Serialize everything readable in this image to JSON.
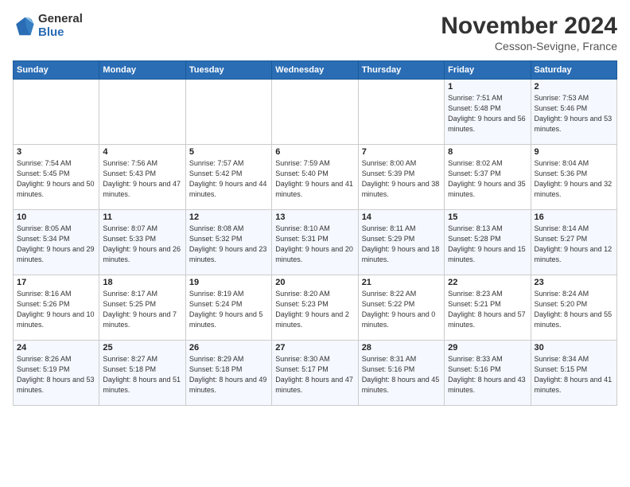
{
  "logo": {
    "general": "General",
    "blue": "Blue"
  },
  "header": {
    "month": "November 2024",
    "location": "Cesson-Sevigne, France"
  },
  "weekdays": [
    "Sunday",
    "Monday",
    "Tuesday",
    "Wednesday",
    "Thursday",
    "Friday",
    "Saturday"
  ],
  "weeks": [
    [
      {
        "day": "",
        "info": ""
      },
      {
        "day": "",
        "info": ""
      },
      {
        "day": "",
        "info": ""
      },
      {
        "day": "",
        "info": ""
      },
      {
        "day": "",
        "info": ""
      },
      {
        "day": "1",
        "info": "Sunrise: 7:51 AM\nSunset: 5:48 PM\nDaylight: 9 hours and 56 minutes."
      },
      {
        "day": "2",
        "info": "Sunrise: 7:53 AM\nSunset: 5:46 PM\nDaylight: 9 hours and 53 minutes."
      }
    ],
    [
      {
        "day": "3",
        "info": "Sunrise: 7:54 AM\nSunset: 5:45 PM\nDaylight: 9 hours and 50 minutes."
      },
      {
        "day": "4",
        "info": "Sunrise: 7:56 AM\nSunset: 5:43 PM\nDaylight: 9 hours and 47 minutes."
      },
      {
        "day": "5",
        "info": "Sunrise: 7:57 AM\nSunset: 5:42 PM\nDaylight: 9 hours and 44 minutes."
      },
      {
        "day": "6",
        "info": "Sunrise: 7:59 AM\nSunset: 5:40 PM\nDaylight: 9 hours and 41 minutes."
      },
      {
        "day": "7",
        "info": "Sunrise: 8:00 AM\nSunset: 5:39 PM\nDaylight: 9 hours and 38 minutes."
      },
      {
        "day": "8",
        "info": "Sunrise: 8:02 AM\nSunset: 5:37 PM\nDaylight: 9 hours and 35 minutes."
      },
      {
        "day": "9",
        "info": "Sunrise: 8:04 AM\nSunset: 5:36 PM\nDaylight: 9 hours and 32 minutes."
      }
    ],
    [
      {
        "day": "10",
        "info": "Sunrise: 8:05 AM\nSunset: 5:34 PM\nDaylight: 9 hours and 29 minutes."
      },
      {
        "day": "11",
        "info": "Sunrise: 8:07 AM\nSunset: 5:33 PM\nDaylight: 9 hours and 26 minutes."
      },
      {
        "day": "12",
        "info": "Sunrise: 8:08 AM\nSunset: 5:32 PM\nDaylight: 9 hours and 23 minutes."
      },
      {
        "day": "13",
        "info": "Sunrise: 8:10 AM\nSunset: 5:31 PM\nDaylight: 9 hours and 20 minutes."
      },
      {
        "day": "14",
        "info": "Sunrise: 8:11 AM\nSunset: 5:29 PM\nDaylight: 9 hours and 18 minutes."
      },
      {
        "day": "15",
        "info": "Sunrise: 8:13 AM\nSunset: 5:28 PM\nDaylight: 9 hours and 15 minutes."
      },
      {
        "day": "16",
        "info": "Sunrise: 8:14 AM\nSunset: 5:27 PM\nDaylight: 9 hours and 12 minutes."
      }
    ],
    [
      {
        "day": "17",
        "info": "Sunrise: 8:16 AM\nSunset: 5:26 PM\nDaylight: 9 hours and 10 minutes."
      },
      {
        "day": "18",
        "info": "Sunrise: 8:17 AM\nSunset: 5:25 PM\nDaylight: 9 hours and 7 minutes."
      },
      {
        "day": "19",
        "info": "Sunrise: 8:19 AM\nSunset: 5:24 PM\nDaylight: 9 hours and 5 minutes."
      },
      {
        "day": "20",
        "info": "Sunrise: 8:20 AM\nSunset: 5:23 PM\nDaylight: 9 hours and 2 minutes."
      },
      {
        "day": "21",
        "info": "Sunrise: 8:22 AM\nSunset: 5:22 PM\nDaylight: 9 hours and 0 minutes."
      },
      {
        "day": "22",
        "info": "Sunrise: 8:23 AM\nSunset: 5:21 PM\nDaylight: 8 hours and 57 minutes."
      },
      {
        "day": "23",
        "info": "Sunrise: 8:24 AM\nSunset: 5:20 PM\nDaylight: 8 hours and 55 minutes."
      }
    ],
    [
      {
        "day": "24",
        "info": "Sunrise: 8:26 AM\nSunset: 5:19 PM\nDaylight: 8 hours and 53 minutes."
      },
      {
        "day": "25",
        "info": "Sunrise: 8:27 AM\nSunset: 5:18 PM\nDaylight: 8 hours and 51 minutes."
      },
      {
        "day": "26",
        "info": "Sunrise: 8:29 AM\nSunset: 5:18 PM\nDaylight: 8 hours and 49 minutes."
      },
      {
        "day": "27",
        "info": "Sunrise: 8:30 AM\nSunset: 5:17 PM\nDaylight: 8 hours and 47 minutes."
      },
      {
        "day": "28",
        "info": "Sunrise: 8:31 AM\nSunset: 5:16 PM\nDaylight: 8 hours and 45 minutes."
      },
      {
        "day": "29",
        "info": "Sunrise: 8:33 AM\nSunset: 5:16 PM\nDaylight: 8 hours and 43 minutes."
      },
      {
        "day": "30",
        "info": "Sunrise: 8:34 AM\nSunset: 5:15 PM\nDaylight: 8 hours and 41 minutes."
      }
    ]
  ]
}
